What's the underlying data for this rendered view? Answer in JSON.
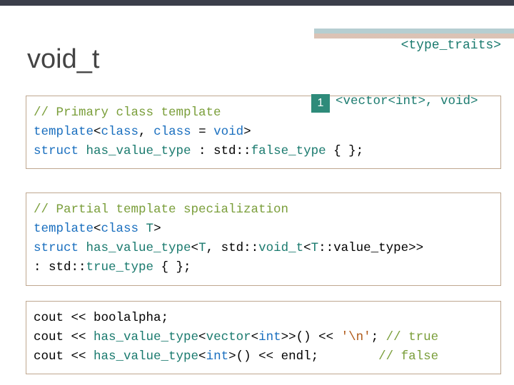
{
  "headerTag": "<type_traits>",
  "title": "void_t",
  "step": {
    "num": "1",
    "label": "<vector<int>, void>"
  },
  "box1": {
    "l1_comment": "// Primary class template",
    "l2_a": "template",
    "l2_b": "<",
    "l2_c": "class",
    "l2_d": ", ",
    "l2_e": "class",
    "l2_f": " = ",
    "l2_g": "void",
    "l2_h": ">",
    "l3_a": "struct ",
    "l3_b": "has_value_type",
    "l3_c": " : std::",
    "l3_d": "false_type",
    "l3_e": " { };"
  },
  "box2": {
    "l1_comment": "// Partial template specialization",
    "l2_a": "template",
    "l2_b": "<",
    "l2_c": "class ",
    "l2_d": "T",
    "l2_e": ">",
    "l3_a": "struct ",
    "l3_b": "has_value_type",
    "l3_c": "<",
    "l3_d": "T",
    "l3_e": ", std::",
    "l3_f": "void_t",
    "l3_g": "<",
    "l3_h": "T",
    "l3_i": "::value_type>>",
    "l4_a": ": std::",
    "l4_b": "true_type",
    "l4_c": " { };"
  },
  "box3": {
    "l1_a": "cout << boolalpha;",
    "l2_a": "cout << ",
    "l2_b": "has_value_type",
    "l2_c": "<",
    "l2_d": "vector",
    "l2_e": "<",
    "l2_f": "int",
    "l2_g": ">>() << ",
    "l2_h": "'\\n'",
    "l2_i": "; ",
    "l2_j": "// true",
    "l3_a": "cout << ",
    "l3_b": "has_value_type",
    "l3_c": "<",
    "l3_d": "int",
    "l3_e": ">() << endl;        ",
    "l3_f": "// false"
  }
}
